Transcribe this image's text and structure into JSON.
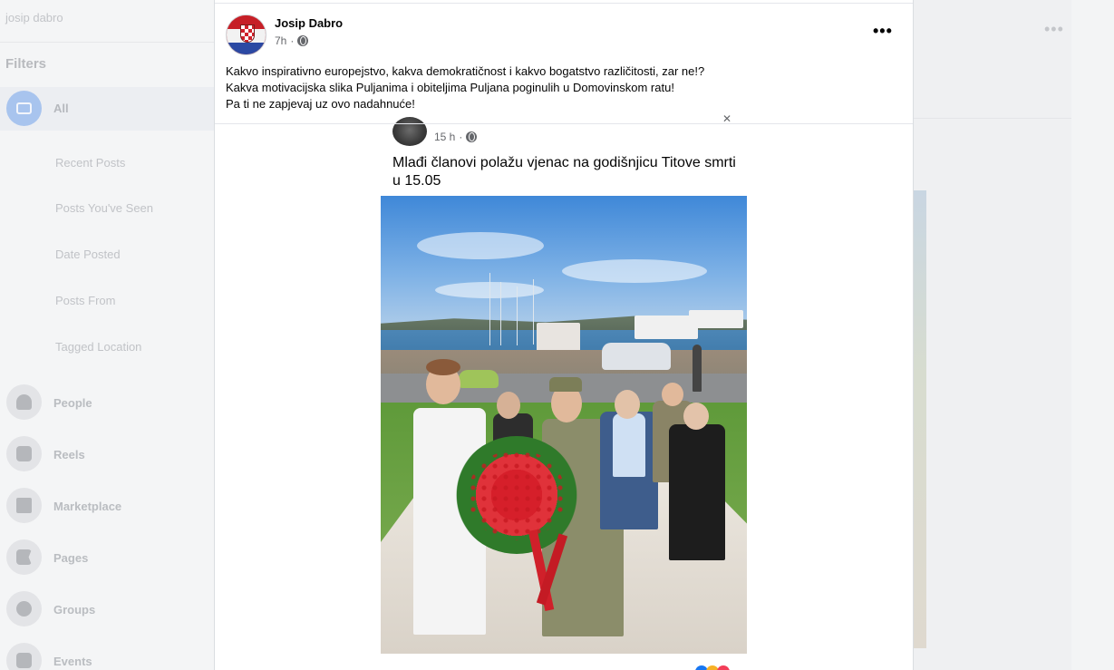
{
  "background": {
    "search_text": "josip dabro",
    "filters_heading": "Filters",
    "all_label": "All",
    "sub_filters": [
      "Recent Posts",
      "Posts You've Seen",
      "Date Posted",
      "Posts From",
      "Tagged Location"
    ],
    "nav_items": [
      {
        "label": "People",
        "icon": "people-icon"
      },
      {
        "label": "Reels",
        "icon": "reels-icon"
      },
      {
        "label": "Marketplace",
        "icon": "marketplace-icon"
      },
      {
        "label": "Pages",
        "icon": "flag-icon"
      },
      {
        "label": "Groups",
        "icon": "groups-icon"
      },
      {
        "label": "Events",
        "icon": "events-icon"
      }
    ],
    "right_dots": "•••"
  },
  "post": {
    "author": "Josip Dabro",
    "time": "7h",
    "meta_sep": "·",
    "privacy_icon": "globe-icon",
    "more_label": "•••",
    "caption": [
      "Kakvo inspirativno europejstvo, kakva demokratičnost i kakvo bogatstvo različitosti, zar ne!?",
      "Kakva motivacijska slika Puljanima i obiteljima Puljana poginulih u Domovinskom ratu!",
      "Pa ti ne zapjevaj uz ovo nadahnuće!"
    ]
  },
  "shared": {
    "time": "15 h",
    "meta_sep": "·",
    "text": "Mlađi članovi polažu vjenac na godišnjicu Titove smrti u 15.05"
  },
  "colors": {
    "accent": "#216fdb",
    "all_icon": "#a8c4ee"
  }
}
